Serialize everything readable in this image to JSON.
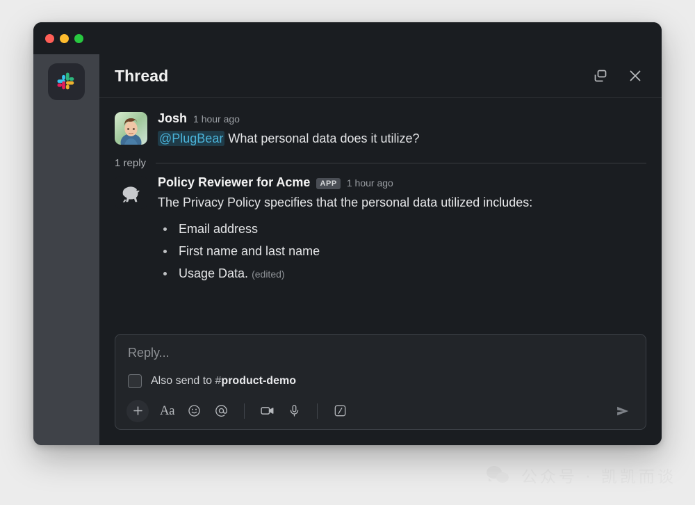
{
  "window": {
    "traffic_lights": [
      "close",
      "minimize",
      "maximize"
    ]
  },
  "sidebar": {
    "workspace_icon": "slack-logo-icon"
  },
  "header": {
    "title": "Thread",
    "actions": [
      {
        "icon": "open-in-split-view-icon",
        "label": "Open in split view"
      },
      {
        "icon": "close-icon",
        "label": "Close"
      }
    ]
  },
  "thread": {
    "parent_message": {
      "avatar": "user-avatar-josh",
      "author": "Josh",
      "timestamp": "1 hour ago",
      "mention": "@PlugBear",
      "text": "What personal data does it utilize?"
    },
    "reply_count_label": "1 reply",
    "reply": {
      "avatar": "plugbear-bear-avatar",
      "author": "Policy Reviewer for Acme",
      "badge": "APP",
      "timestamp": "1 hour ago",
      "text": "The Privacy Policy specifies that the personal data utilized includes:",
      "bullets": [
        {
          "text": "Email address",
          "edited": ""
        },
        {
          "text": "First name and last name",
          "edited": ""
        },
        {
          "text": "Usage Data.",
          "edited": "(edited)"
        }
      ]
    }
  },
  "composer": {
    "placeholder": "Reply...",
    "also_send": {
      "checked": false,
      "prefix": "Also send to",
      "hash": "#",
      "channel": "product-demo"
    },
    "toolbar": [
      {
        "icon": "plus-icon",
        "label": "Add attachment"
      },
      {
        "icon": "text-formatting-icon",
        "label": "Aa"
      },
      {
        "icon": "emoji-icon",
        "label": "Emoji"
      },
      {
        "icon": "mention-icon",
        "label": "Mention someone"
      },
      {
        "icon": "video-clip-icon",
        "label": "Record video clip"
      },
      {
        "icon": "audio-clip-icon",
        "label": "Record audio clip"
      },
      {
        "icon": "shortcuts-icon",
        "label": "Shortcuts"
      }
    ],
    "send_icon": "send-icon"
  },
  "watermark": {
    "icon": "wechat-icon",
    "text": "公众号 · 凯凯而谈"
  },
  "colors": {
    "app_bg": "#1a1d21",
    "sidebar_bg": "#3f4248",
    "mention_text": "#4ab3d9",
    "mention_bg": "#1f3b48",
    "page_bg": "#ececec"
  }
}
